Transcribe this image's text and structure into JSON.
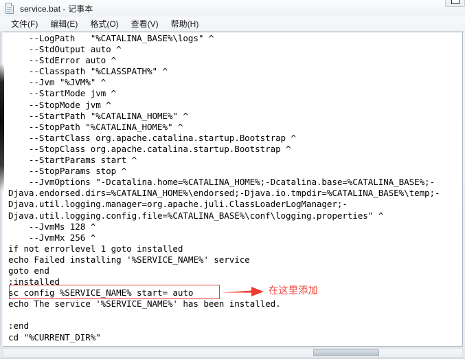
{
  "window": {
    "title": "service.bat - 记事本",
    "icon": "notepad-document-icon",
    "restore_button_label": "",
    "accent_red": "#ef4136",
    "box_red": "#e8413a"
  },
  "menubar": {
    "items": [
      {
        "label": "文件(F)",
        "name": "menu-file"
      },
      {
        "label": "编辑(E)",
        "name": "menu-edit"
      },
      {
        "label": "格式(O)",
        "name": "menu-format"
      },
      {
        "label": "查看(V)",
        "name": "menu-view"
      },
      {
        "label": "帮助(H)",
        "name": "menu-help"
      }
    ]
  },
  "editor": {
    "content": "    --LogPath   \"%CATALINA_BASE%\\logs\" ^\n    --StdOutput auto ^\n    --StdError auto ^\n    --Classpath \"%CLASSPATH%\" ^\n    --Jvm \"%JVM%\" ^\n    --StartMode jvm ^\n    --StopMode jvm ^\n    --StartPath \"%CATALINA_HOME%\" ^\n    --StopPath \"%CATALINA_HOME%\" ^\n    --StartClass org.apache.catalina.startup.Bootstrap ^\n    --StopClass org.apache.catalina.startup.Bootstrap ^\n    --StartParams start ^\n    --StopParams stop ^\n    --JvmOptions \"-Dcatalina.home=%CATALINA_HOME%;-Dcatalina.base=%CATALINA_BASE%;-\nDjava.endorsed.dirs=%CATALINA_HOME%\\endorsed;-Djava.io.tmpdir=%CATALINA_BASE%\\temp;-\nDjava.util.logging.manager=org.apache.juli.ClassLoaderLogManager;-\nDjava.util.logging.config.file=%CATALINA_BASE%\\conf\\logging.properties\" ^\n    --JvmMs 128 ^\n    --JvmMx 256 ^\nif not errorlevel 1 goto installed\necho Failed installing '%SERVICE_NAME%' service\ngoto end\n:installed\nsc config %SERVICE_NAME% start= auto\necho The service '%SERVICE_NAME%' has been installed.\n\n:end\ncd \"%CURRENT_DIR%\"",
    "highlighted_line": "sc config %SERVICE_NAME% start= auto"
  },
  "annotation": {
    "label": "在这里添加",
    "arrow": "right-arrow"
  }
}
